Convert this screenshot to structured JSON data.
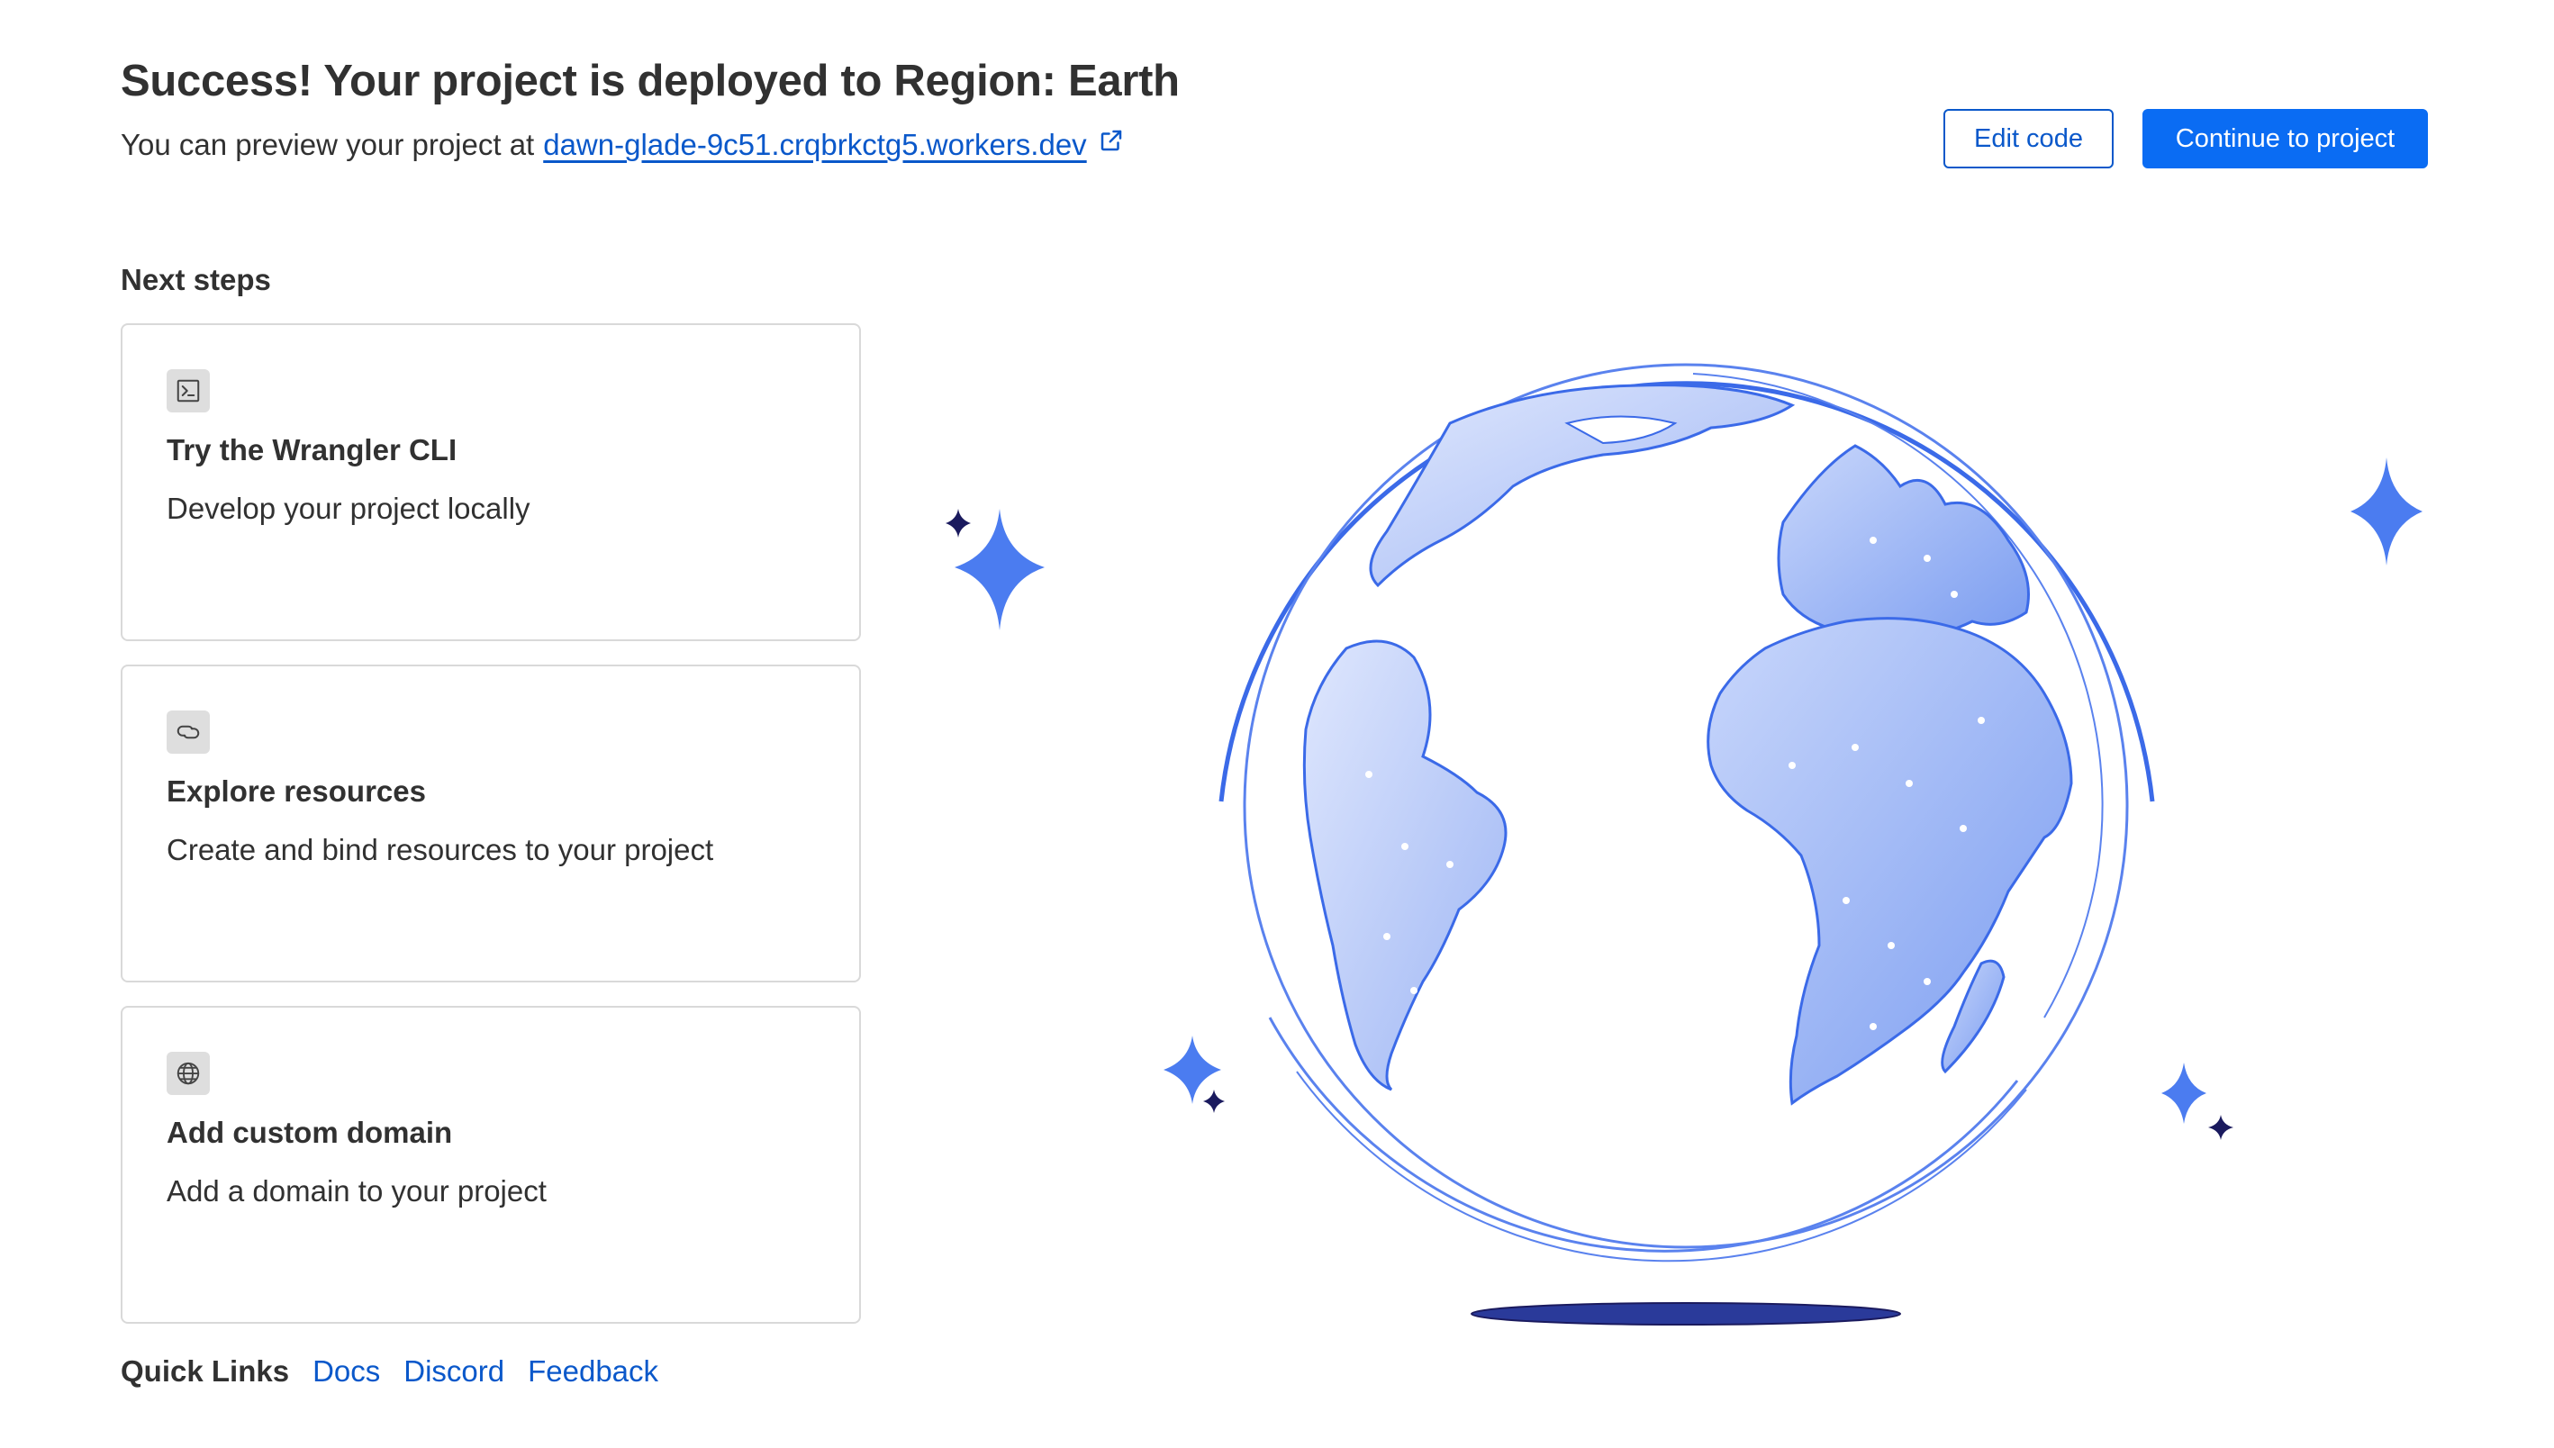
{
  "header": {
    "title": "Success! Your project is deployed to Region: Earth",
    "preview_prefix": "You can preview your project at",
    "preview_url": "dawn-glade-9c51.crqbrkctg5.workers.dev"
  },
  "actions": {
    "edit_label": "Edit code",
    "continue_label": "Continue to project"
  },
  "next_steps": {
    "heading": "Next steps",
    "cards": [
      {
        "icon": "terminal-icon",
        "title": "Try the Wrangler CLI",
        "description": "Develop your project locally"
      },
      {
        "icon": "link-icon",
        "title": "Explore resources",
        "description": "Create and bind resources to your project"
      },
      {
        "icon": "globe-icon",
        "title": "Add custom domain",
        "description": "Add a domain to your project"
      }
    ]
  },
  "quick_links": {
    "label": "Quick Links",
    "links": [
      "Docs",
      "Discord",
      "Feedback"
    ]
  },
  "colors": {
    "primary": "#0a6cf3",
    "link": "#0a58ca",
    "globe_stroke": "#3b6ae8",
    "globe_fill": "#86a5f2",
    "star": "#4b7cf0",
    "star_dark": "#1a1a5e",
    "shadow": "#2a3a9a"
  },
  "illustration": {
    "icon": "earth-globe-icon"
  }
}
